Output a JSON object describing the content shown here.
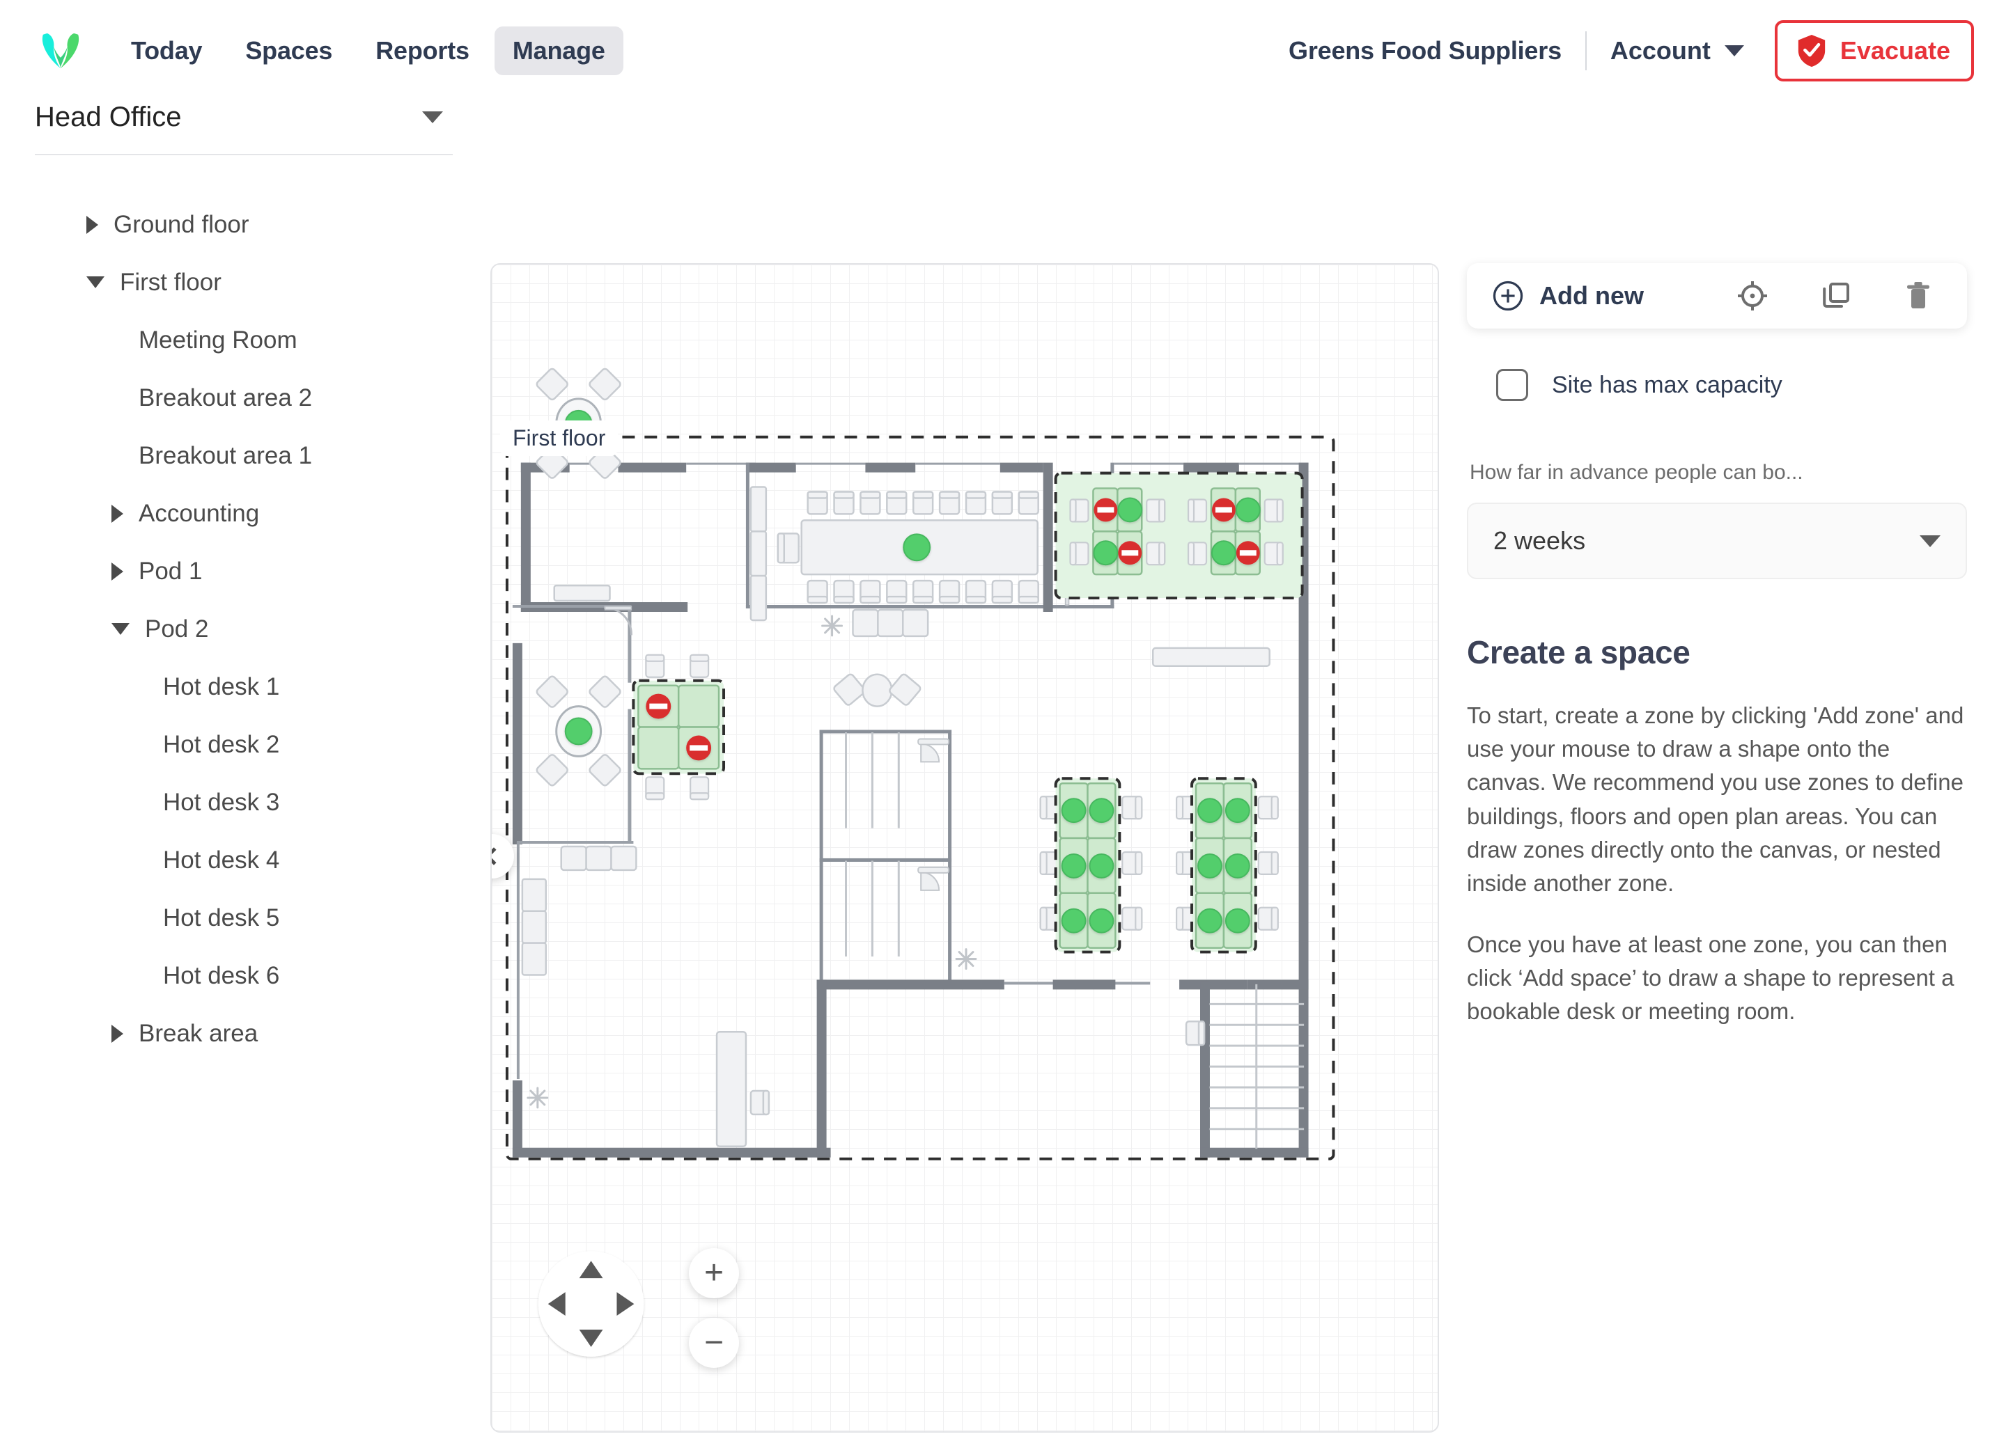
{
  "header": {
    "logo_icon": "heart-logo",
    "nav": [
      {
        "label": "Today",
        "active": false
      },
      {
        "label": "Spaces",
        "active": false
      },
      {
        "label": "Reports",
        "active": false
      },
      {
        "label": "Manage",
        "active": true
      }
    ],
    "org_name": "Greens Food Suppliers",
    "account_label": "Account",
    "account_caret_icon": "chevron-down-icon",
    "evacuate_label": "Evacuate",
    "evacuate_icon": "shield-check-icon",
    "evacuate_color": "#e8333a"
  },
  "sidebar": {
    "site_name": "Head Office",
    "site_caret_icon": "caret-down-icon",
    "tree": [
      {
        "label": "Ground floor",
        "level": 1,
        "toggle": "closed"
      },
      {
        "label": "First floor",
        "level": 1,
        "toggle": "open"
      },
      {
        "label": "Meeting Room",
        "level": 2,
        "toggle": "none"
      },
      {
        "label": "Breakout area 2",
        "level": 2,
        "toggle": "none"
      },
      {
        "label": "Breakout area 1",
        "level": 2,
        "toggle": "none"
      },
      {
        "label": "Accounting",
        "level": 2,
        "toggle": "closed"
      },
      {
        "label": "Pod 1",
        "level": 2,
        "toggle": "closed"
      },
      {
        "label": "Pod 2",
        "level": 2,
        "toggle": "open"
      },
      {
        "label": "Hot desk 1",
        "level": 3,
        "toggle": "none"
      },
      {
        "label": "Hot desk 2",
        "level": 3,
        "toggle": "none"
      },
      {
        "label": "Hot desk 3",
        "level": 3,
        "toggle": "none"
      },
      {
        "label": "Hot desk 4",
        "level": 3,
        "toggle": "none"
      },
      {
        "label": "Hot desk 5",
        "level": 3,
        "toggle": "none"
      },
      {
        "label": "Hot desk 6",
        "level": 3,
        "toggle": "none"
      },
      {
        "label": "Break area",
        "level": 2,
        "toggle": "closed"
      }
    ],
    "collapse_icon": "chevron-left-icon"
  },
  "canvas": {
    "floor_label": "First floor",
    "pan_icons": {
      "up": "arrow-up-icon",
      "down": "arrow-down-icon",
      "left": "arrow-left-icon",
      "right": "arrow-right-icon"
    },
    "zoom_in_label": "+",
    "zoom_out_label": "−",
    "colors": {
      "zone_fill": "#e2f4e3",
      "zone_border": "#333333",
      "space_fill": "#cfeacf",
      "space_border": "#8cbd92",
      "available_dot": "#52ce6c",
      "blocked_dot": "#d92d2d",
      "wall": "#7a7f87",
      "furniture": "#f1f2f4"
    },
    "spaces": [
      {
        "name": "Breakout area 1",
        "status": "available"
      },
      {
        "name": "Meeting Room",
        "status": "available"
      },
      {
        "name": "Breakout area 2",
        "status": "available"
      },
      {
        "name": "Accounting",
        "status": "mixed",
        "desks": [
          "blocked",
          "available",
          "available",
          "blocked"
        ]
      },
      {
        "name": "Break area",
        "status": "mixed",
        "desks": [
          "blocked",
          "available",
          "available",
          "blocked"
        ]
      },
      {
        "name": "Pod 1",
        "status": "available",
        "desks": [
          "available",
          "available",
          "available",
          "available",
          "available",
          "available"
        ]
      },
      {
        "name": "Pod 2",
        "status": "available",
        "desks": [
          "available",
          "available",
          "available",
          "available",
          "available",
          "available"
        ]
      }
    ]
  },
  "right_panel": {
    "add_new_label": "Add new",
    "add_new_icon": "plus-circle-icon",
    "tools": [
      {
        "icon": "target-icon",
        "name": "center-view"
      },
      {
        "icon": "copy-icon",
        "name": "duplicate"
      },
      {
        "icon": "trash-icon",
        "name": "delete"
      }
    ],
    "max_capacity_label": "Site has max capacity",
    "max_capacity_checked": false,
    "advance_booking_label": "How far in advance people can bo...",
    "advance_booking_value": "2 weeks",
    "advance_booking_caret_icon": "caret-down-icon",
    "help_title": "Create a space",
    "help_paragraphs": [
      "To start, create a zone by clicking 'Add zone' and use your mouse to draw a shape onto the canvas. We recommend you use zones to define buildings, floors and open plan areas. You can draw zones directly onto the canvas, or nested inside another zone.",
      "Once you have at least one zone, you can then click ‘Add space’ to draw a shape to represent a bookable desk or meeting room."
    ]
  }
}
